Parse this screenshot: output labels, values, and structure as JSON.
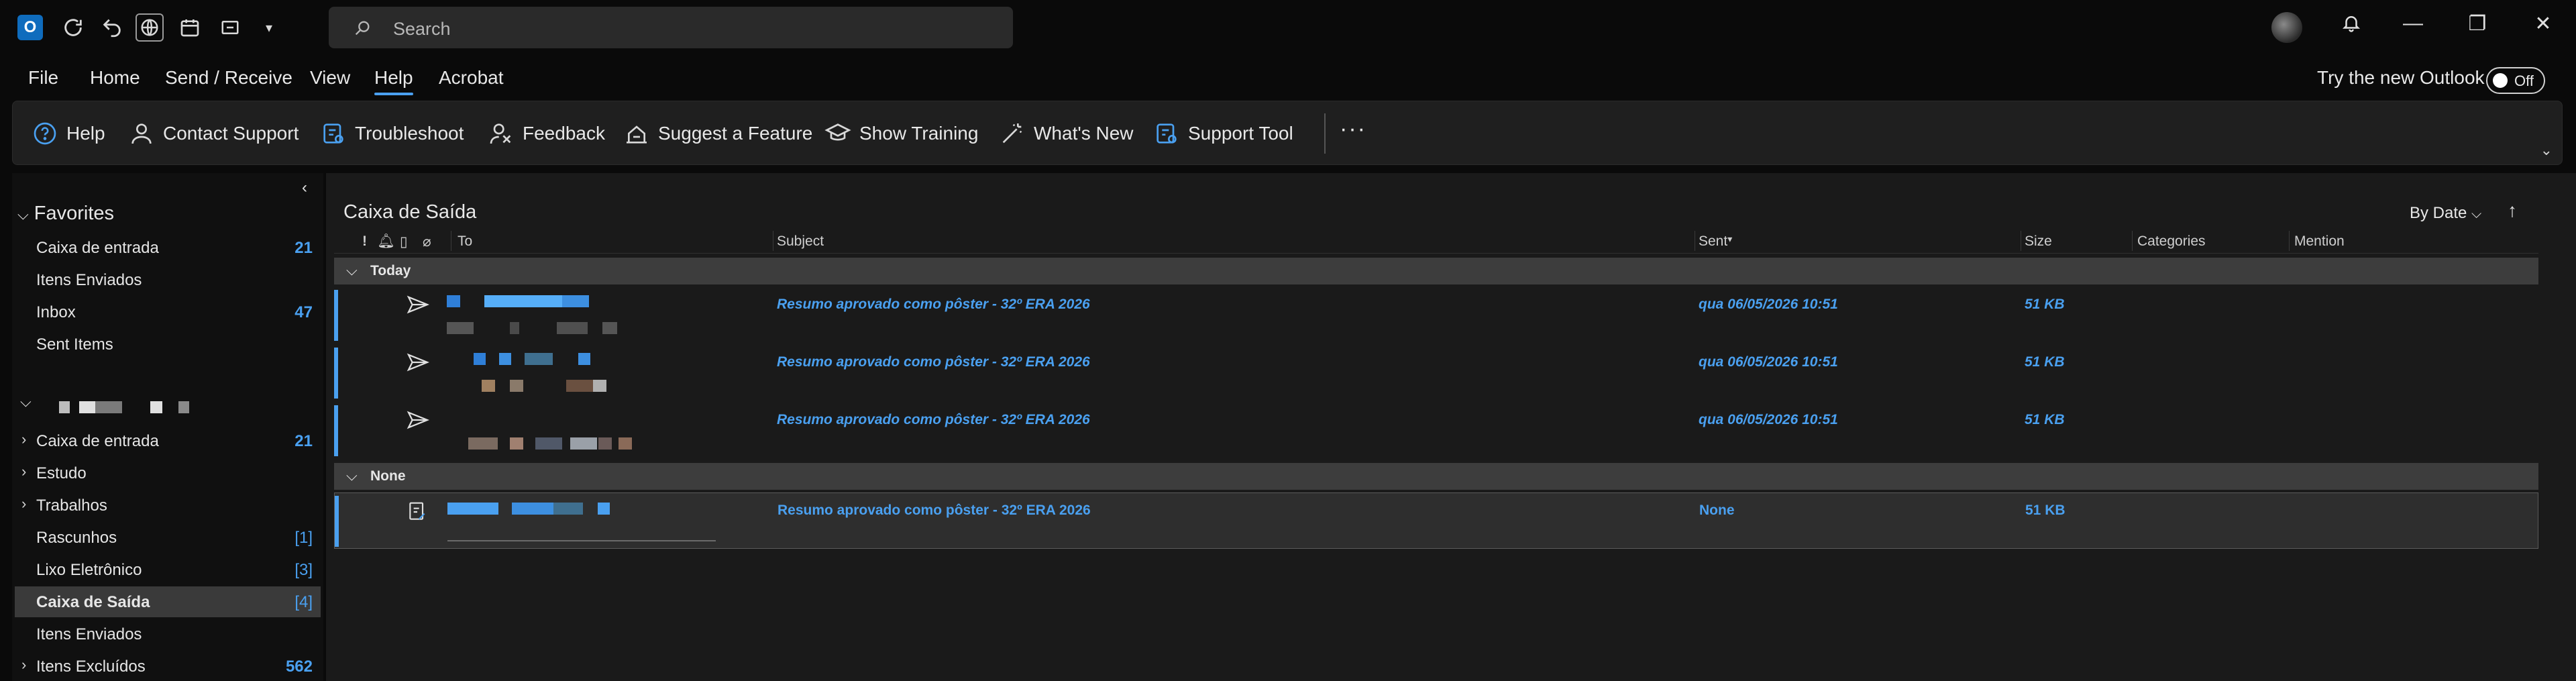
{
  "titlebar": {
    "search_placeholder": "Search"
  },
  "menu": {
    "items": [
      "File",
      "Home",
      "Send / Receive",
      "View",
      "Help",
      "Acrobat"
    ],
    "active": "Help",
    "try_new": "Try the new Outlook",
    "toggle": "Off"
  },
  "ribbon": {
    "buttons": [
      "Help",
      "Contact Support",
      "Troubleshoot",
      "Feedback",
      "Suggest a Feature",
      "Show Training",
      "What's New",
      "Support Tool"
    ]
  },
  "folders": {
    "favorites_header": "Favorites",
    "favorites": [
      {
        "name": "Caixa de entrada",
        "count": "21"
      },
      {
        "name": "Itens Enviados",
        "count": ""
      },
      {
        "name": "Inbox",
        "count": "47"
      },
      {
        "name": "Sent Items",
        "count": ""
      }
    ],
    "account": [
      {
        "name": "Caixa de entrada",
        "count": "21",
        "expandable": true
      },
      {
        "name": "Estudo",
        "count": "",
        "expandable": true
      },
      {
        "name": "Trabalhos",
        "count": "",
        "expandable": true
      },
      {
        "name": "Rascunhos",
        "count": "[1]",
        "expandable": false
      },
      {
        "name": "Lixo Eletrônico",
        "count": "[3]",
        "expandable": false
      },
      {
        "name": "Caixa de Saída",
        "count": "[4]",
        "expandable": false,
        "selected": true
      },
      {
        "name": "Itens Enviados",
        "count": "",
        "expandable": false
      },
      {
        "name": "Itens Excluídos",
        "count": "562",
        "expandable": true
      }
    ]
  },
  "list": {
    "folder_title": "Caixa de Saída",
    "sort": "By Date",
    "columns": [
      "!",
      "To",
      "Subject",
      "Sent",
      "Size",
      "Categories",
      "Mention"
    ],
    "groups": [
      {
        "label": "Today",
        "messages": [
          {
            "subject": "Resumo aprovado como pôster - 32º ERA 2026",
            "sent": "qua 06/05/2026 10:51",
            "size": "51 KB"
          },
          {
            "subject": "Resumo aprovado como pôster - 32º ERA 2026",
            "sent": "qua 06/05/2026 10:51",
            "size": "51 KB"
          },
          {
            "subject": "Resumo aprovado como pôster - 32º ERA 2026",
            "sent": "qua 06/05/2026 10:51",
            "size": "51 KB"
          }
        ]
      },
      {
        "label": "None",
        "messages": [
          {
            "subject": "Resumo aprovado como pôster - 32º ERA 2026",
            "sent": "None",
            "size": "51 KB"
          }
        ]
      }
    ]
  },
  "colors": {
    "accent": "#4aa0f0",
    "background": "#0a0a0a",
    "pane": "#1a1a1a",
    "group_header": "#3d3d3d"
  }
}
